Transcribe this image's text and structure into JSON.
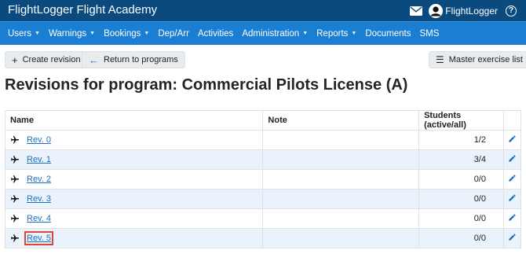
{
  "header": {
    "app_title": "FlightLogger Flight Academy",
    "user_name": "FlightLogger"
  },
  "nav": {
    "items": [
      {
        "label": "Users",
        "dropdown": true
      },
      {
        "label": "Warnings",
        "dropdown": true
      },
      {
        "label": "Bookings",
        "dropdown": true
      },
      {
        "label": "Dep/Arr",
        "dropdown": false
      },
      {
        "label": "Activities",
        "dropdown": false
      },
      {
        "label": "Administration",
        "dropdown": true
      },
      {
        "label": "Reports",
        "dropdown": true
      },
      {
        "label": "Documents",
        "dropdown": false
      },
      {
        "label": "SMS",
        "dropdown": false
      }
    ]
  },
  "toolbar": {
    "create_revision": "Create revision",
    "return_to_programs": "Return to programs",
    "master_exercise_list": "Master exercise list"
  },
  "page_title": "Revisions for program: Commercial Pilots License (A)",
  "table": {
    "columns": [
      "Name",
      "Note",
      "Students (active/all)"
    ],
    "rows": [
      {
        "name": "Rev. 0",
        "note": "",
        "students": "1/2"
      },
      {
        "name": "Rev. 1",
        "note": "",
        "students": "3/4"
      },
      {
        "name": "Rev. 2",
        "note": "",
        "students": "0/0"
      },
      {
        "name": "Rev. 3",
        "note": "",
        "students": "0/0"
      },
      {
        "name": "Rev. 4",
        "note": "",
        "students": "0/0"
      },
      {
        "name": "Rev. 5",
        "note": "",
        "students": "0/0",
        "highlighted": true
      }
    ]
  },
  "colors": {
    "topbar": "#0b4a7e",
    "navbar": "#1a7fd3",
    "link": "#1a6fc4",
    "highlight_box": "#e0443a"
  }
}
